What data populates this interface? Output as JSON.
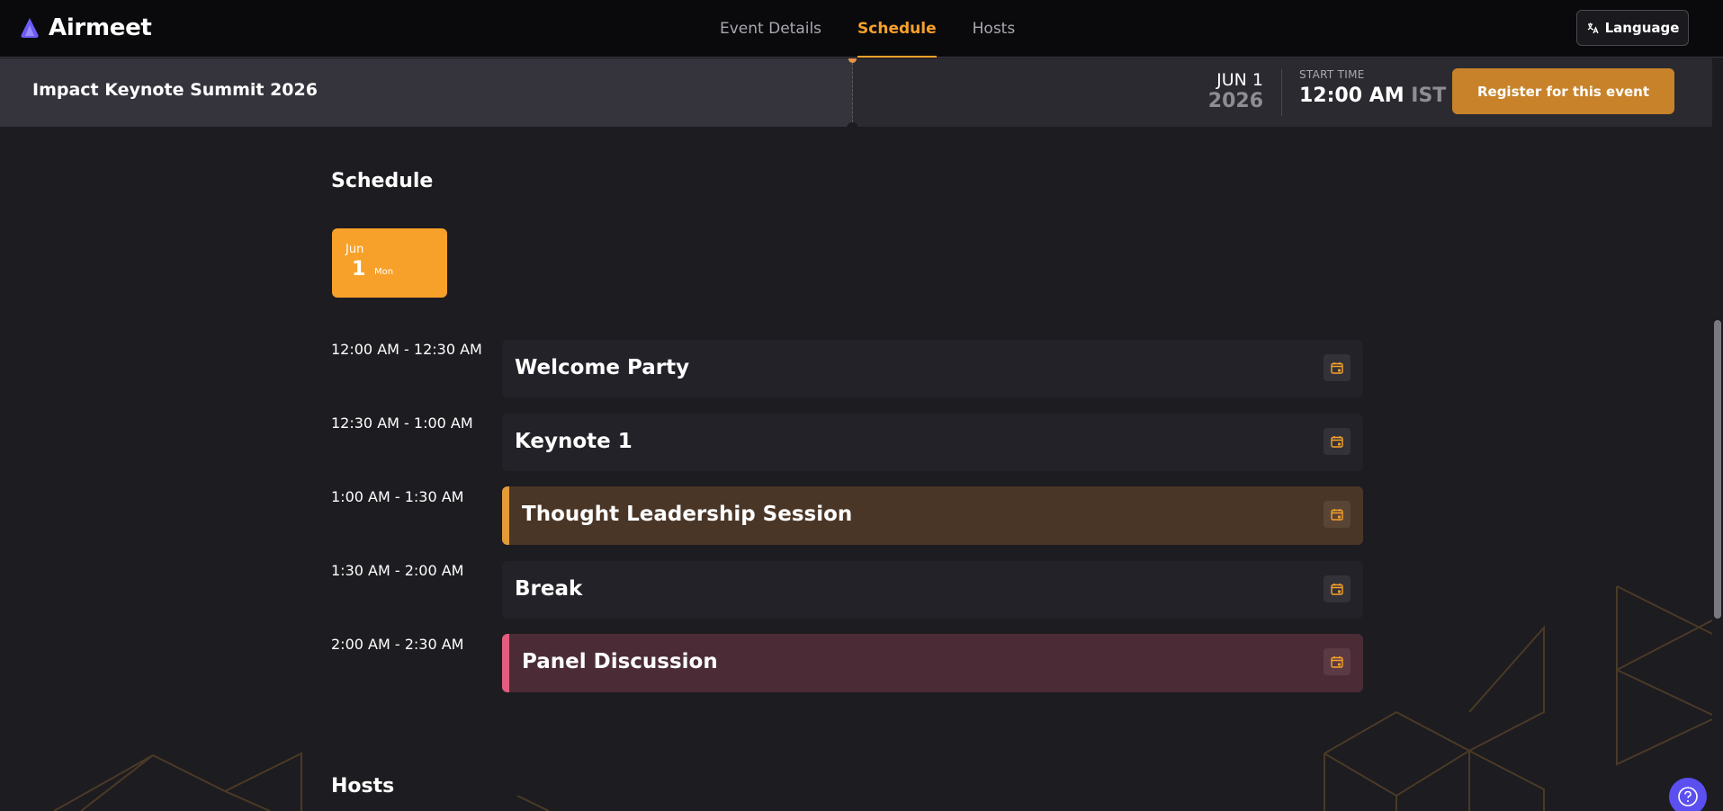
{
  "header": {
    "logo": "Airmeet",
    "tabs": [
      {
        "label": "Event Details",
        "active": false
      },
      {
        "label": "Schedule",
        "active": true
      },
      {
        "label": "Hosts",
        "active": false
      }
    ],
    "language_label": "Language"
  },
  "event": {
    "title": "Impact Keynote Summit 2026",
    "date_month": "JUN 1",
    "date_year": "2026",
    "start_label": "START TIME",
    "start_time": "12:00 AM",
    "start_tz": "IST",
    "register_label": "Register for this event"
  },
  "schedule": {
    "title": "Schedule",
    "day": {
      "month": "Jun",
      "day": "1",
      "weekday": "Mon"
    },
    "sessions": [
      {
        "time": "12:00 AM - 12:30 AM",
        "title": "Welcome Party",
        "accent": ""
      },
      {
        "time": "12:30 AM - 1:00 AM",
        "title": "Keynote 1",
        "accent": ""
      },
      {
        "time": "1:00 AM - 1:30 AM",
        "title": "Thought Leadership Session",
        "accent": "#e39a37",
        "bg": "#4a3627"
      },
      {
        "time": "1:30 AM - 2:00 AM",
        "title": "Break",
        "accent": ""
      },
      {
        "time": "2:00 AM - 2:30 AM",
        "title": "Panel Discussion",
        "accent": "#e35d7e",
        "bg": "#4b2c36"
      }
    ]
  },
  "hosts": {
    "title": "Hosts"
  },
  "colors": {
    "accent": "#f7a12a",
    "brand_logo": "#6c5cf5",
    "help": "#5b4ff0"
  }
}
